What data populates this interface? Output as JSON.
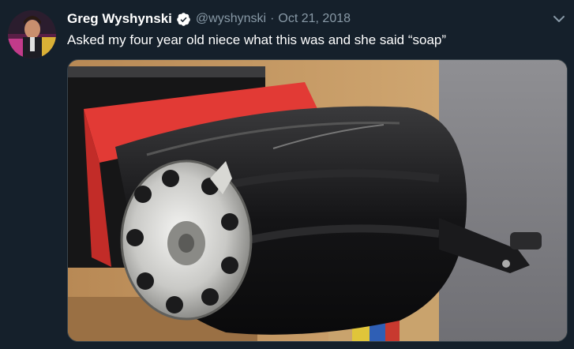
{
  "tweet": {
    "author_name": "Greg Wyshynski",
    "verified": true,
    "handle": "@wyshynski",
    "separator": "·",
    "date": "Oct 21, 2018",
    "text": "Asked my four year old niece what this was and she said “soap”"
  },
  "icons": {
    "verified": "verified-badge-icon",
    "menu": "chevron-down-icon"
  },
  "colors": {
    "background": "#15202b",
    "secondary_text": "#8899a6",
    "verified": "#ffffff",
    "tape": "#e23a35"
  }
}
